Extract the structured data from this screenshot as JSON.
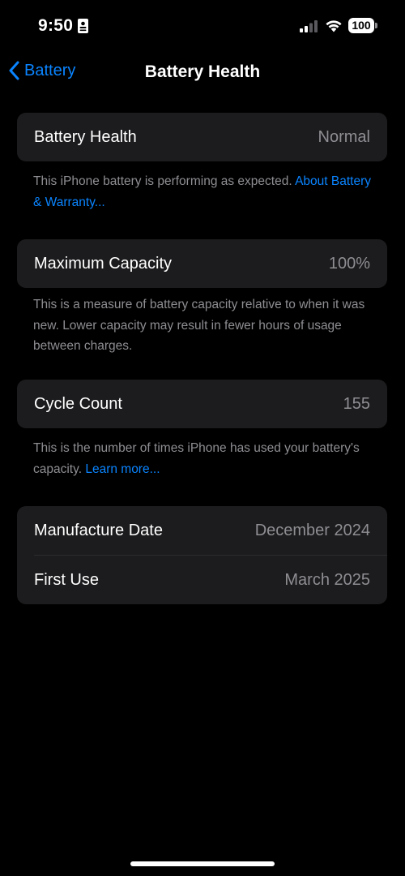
{
  "status_bar": {
    "time": "9:50",
    "battery_level": "100",
    "signal_bars_active": 2,
    "signal_bars_total": 4,
    "icons": [
      "id-card-icon",
      "signal-icon",
      "wifi-icon",
      "battery-icon"
    ]
  },
  "nav": {
    "back_label": "Battery",
    "title": "Battery Health"
  },
  "sections": {
    "health": {
      "label": "Battery Health",
      "value": "Normal",
      "footnote_text": "This iPhone battery is performing as expected. ",
      "footnote_link": "About Battery & Warranty..."
    },
    "capacity": {
      "label": "Maximum Capacity",
      "value": "100%",
      "footnote_text": "This is a measure of battery capacity relative to when it was new. Lower capacity may result in fewer hours of usage between charges."
    },
    "cycle": {
      "label": "Cycle Count",
      "value": "155",
      "footnote_text": "This is the number of times iPhone has used your battery's capacity. ",
      "footnote_link": "Learn more..."
    },
    "dates": {
      "manufacture_label": "Manufacture Date",
      "manufacture_value": "December 2024",
      "first_use_label": "First Use",
      "first_use_value": "March 2025"
    }
  },
  "colors": {
    "background": "#000000",
    "cell": "#1c1c1e",
    "accent": "#0a84ff",
    "secondary_text": "#8e8e93"
  }
}
